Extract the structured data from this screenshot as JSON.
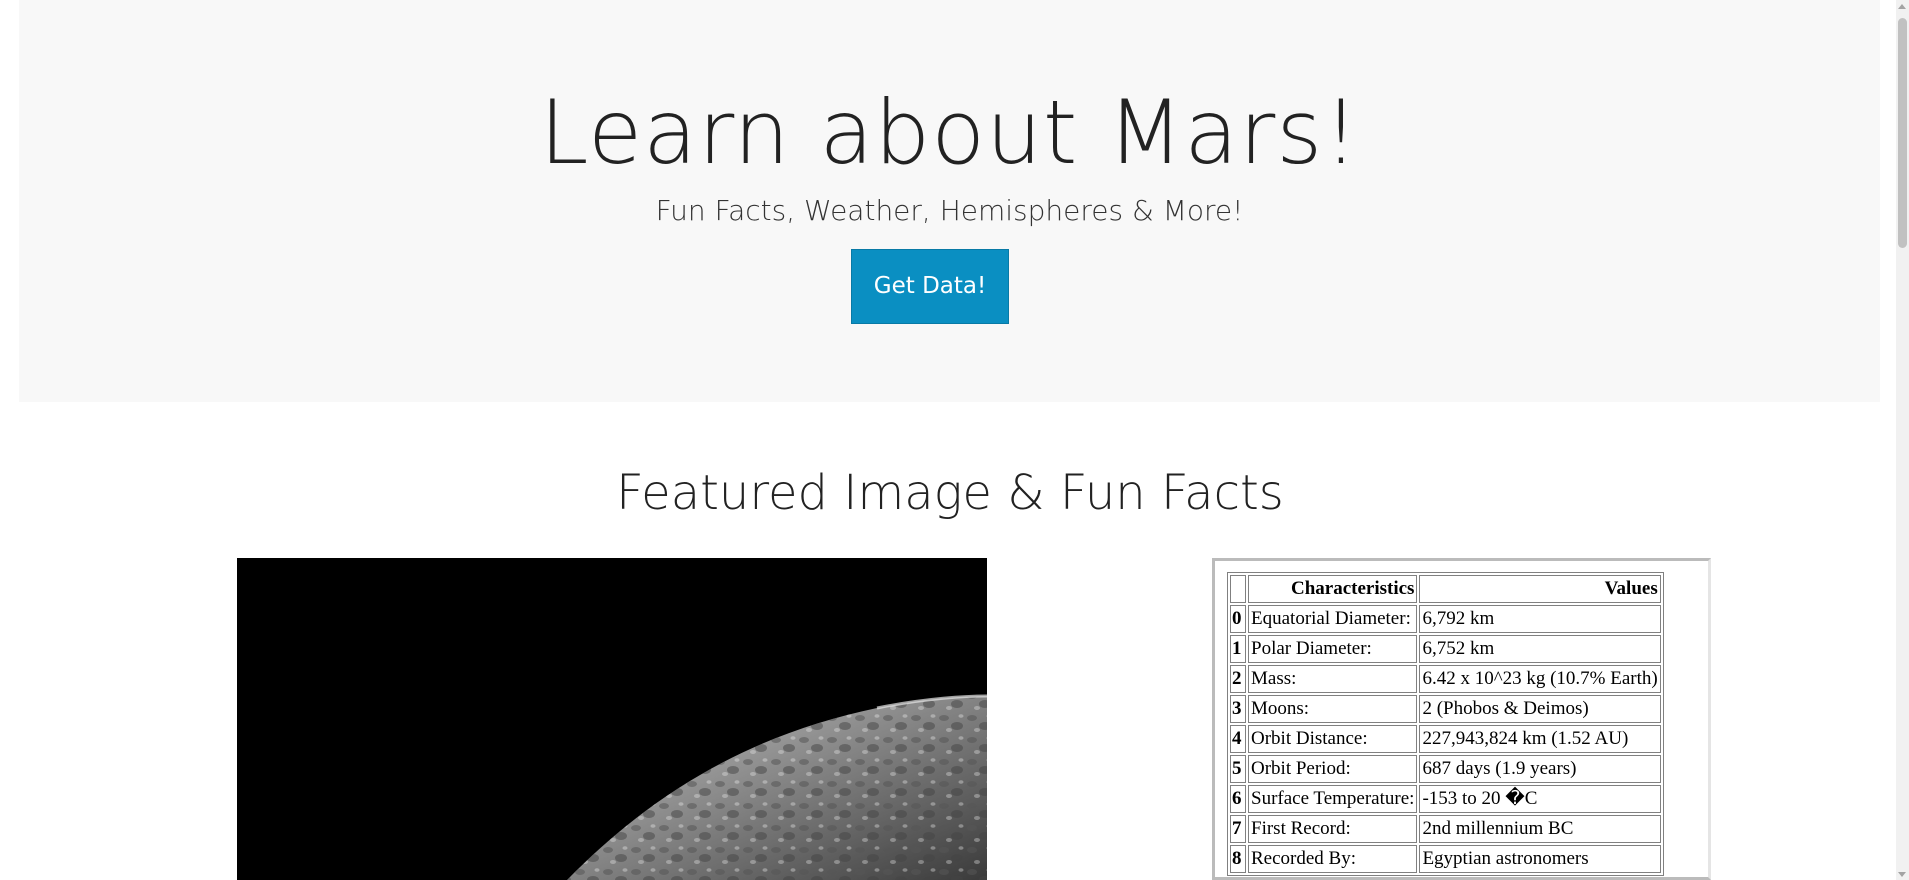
{
  "jumbotron": {
    "title": "Learn about Mars!",
    "subtitle": "Fun Facts, Weather, Hemispheres & More!",
    "button_label": "Get Data!"
  },
  "featured": {
    "section_title": "Featured Image & Fun Facts"
  },
  "facts_table": {
    "headers": [
      "",
      "Characteristics",
      "Values"
    ],
    "rows": [
      {
        "index": "0",
        "characteristic": "Equatorial Diameter:",
        "value": "6,792 km"
      },
      {
        "index": "1",
        "characteristic": "Polar Diameter:",
        "value": "6,752 km"
      },
      {
        "index": "2",
        "characteristic": "Mass:",
        "value": "6.42 x 10^23 kg (10.7% Earth)"
      },
      {
        "index": "3",
        "characteristic": "Moons:",
        "value": "2 (Phobos & Deimos)"
      },
      {
        "index": "4",
        "characteristic": "Orbit Distance:",
        "value": "227,943,824 km (1.52 AU)"
      },
      {
        "index": "5",
        "characteristic": "Orbit Period:",
        "value": "687 days (1.9 years)"
      },
      {
        "index": "6",
        "characteristic": "Surface Temperature:",
        "value": "-153 to 20 �C"
      },
      {
        "index": "7",
        "characteristic": "First Record:",
        "value": "2nd millennium BC"
      },
      {
        "index": "8",
        "characteristic": "Recorded By:",
        "value": "Egyptian astronomers"
      }
    ]
  },
  "colors": {
    "jumbotron_bg": "#f8f8f8",
    "button_bg": "#0a8fc2",
    "button_text": "#ffffff"
  }
}
